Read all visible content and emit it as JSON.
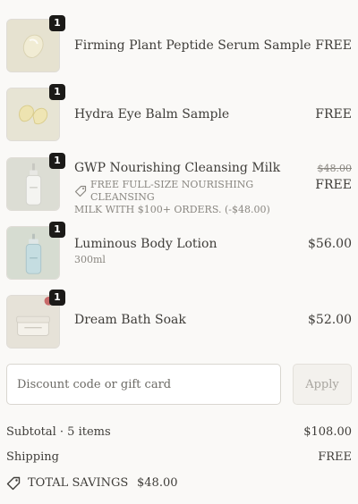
{
  "items": [
    {
      "name": "Firming Plant Peptide Serum Sample",
      "price": "FREE",
      "quantity": "1",
      "image": "serum-sample-image"
    },
    {
      "name": "Hydra Eye Balm Sample",
      "price": "FREE",
      "quantity": "1",
      "image": "eye-balm-sample-image"
    },
    {
      "name": "GWP Nourishing Cleansing Milk",
      "price": "FREE",
      "original_price": "$48.00",
      "quantity": "1",
      "image": "cleansing-milk-image",
      "discount_line1": "FREE FULL-SIZE NOURISHING CLEANSING",
      "discount_line2": "MILK WITH $100+ ORDERS. (-$48.00)"
    },
    {
      "name": "Luminous Body Lotion",
      "price": "$56.00",
      "quantity": "1",
      "variant": "300ml",
      "image": "body-lotion-image"
    },
    {
      "name": "Dream Bath Soak",
      "price": "$52.00",
      "quantity": "1",
      "image": "bath-soak-image"
    }
  ],
  "discount": {
    "placeholder": "Discount code or gift card",
    "apply_label": "Apply"
  },
  "summary": {
    "subtotal_label": "Subtotal · 5 items",
    "subtotal_value": "$108.00",
    "shipping_label": "Shipping",
    "shipping_value": "FREE",
    "savings_label": "TOTAL SAVINGS",
    "savings_value": "$48.00"
  },
  "colors": {
    "background": "#faf9f7",
    "text": "#3f3d39",
    "muted": "#8a8781",
    "badge": "#1b1a18"
  }
}
